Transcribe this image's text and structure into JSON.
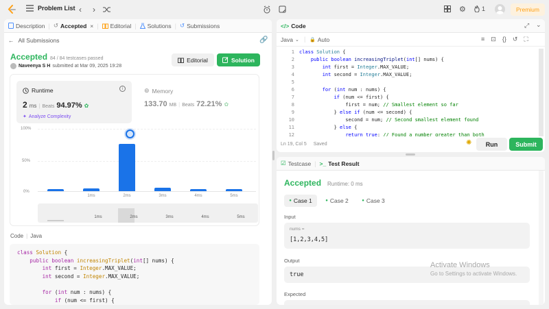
{
  "topbar": {
    "problem_list": "Problem List",
    "notifications": "1",
    "premium": "Premium"
  },
  "left_tabs": [
    {
      "label": "Description"
    },
    {
      "label": "Accepted"
    },
    {
      "label": "Editorial"
    },
    {
      "label": "Solutions"
    },
    {
      "label": "Submissions"
    }
  ],
  "submission": {
    "back": "All Submissions",
    "status": "Accepted",
    "passed": "84 / 84 testcases passed",
    "user": "Naveenya S H",
    "submitted": "submitted at Mar 09, 2025 19:28",
    "editorial_btn": "Editorial",
    "solution_btn": "Solution",
    "runtime_label": "Runtime",
    "runtime_value": "2",
    "runtime_unit": "ms",
    "beats": "Beats",
    "runtime_beats": "94.97%",
    "analyze": "Analyze Complexity",
    "memory_label": "Memory",
    "memory_value": "133.70",
    "memory_unit": "MB",
    "memory_beats": "72.21%"
  },
  "chart_data": {
    "type": "bar",
    "ylabels": [
      "100%",
      "50%",
      "0%"
    ],
    "categories": [
      "",
      "1ms",
      "2ms",
      "3ms",
      "4ms",
      "5ms"
    ],
    "values": [
      3,
      4,
      76,
      5,
      3,
      3
    ],
    "ylim": [
      0,
      100
    ],
    "mini_labels": [
      "1ms",
      "2ms",
      "3ms",
      "4ms",
      "5ms"
    ]
  },
  "left_code": {
    "label": "Code",
    "lang": "Java",
    "lines": [
      "class Solution {",
      "    public boolean increasingTriplet(int[] nums) {",
      "        int first = Integer.MAX_VALUE;",
      "        int second = Integer.MAX_VALUE;",
      "",
      "        for (int num : nums) {",
      "            if (num <= first) {"
    ]
  },
  "editor": {
    "title": "Code",
    "lang": "Java",
    "auto": "Auto",
    "lines": [
      "class Solution {",
      "    public boolean increasingTriplet(int[] nums) {",
      "        int first = Integer.MAX_VALUE;",
      "        int second = Integer.MAX_VALUE;",
      "",
      "        for (int num : nums) {",
      "            if (num <= first) {",
      "                first = num; // Smallest element so far",
      "            } else if (num <= second) {",
      "                second = num; // Second smallest element found",
      "            } else {",
      "                return true; // Found a number greater than both"
    ],
    "status": "Ln 19, Col 5",
    "saved": "Saved",
    "run": "Run",
    "submit": "Submit"
  },
  "result": {
    "testcase_tab": "Testcase",
    "result_tab": "Test Result",
    "status": "Accepted",
    "runtime": "Runtime: 0 ms",
    "cases": [
      "Case 1",
      "Case 2",
      "Case 3"
    ],
    "input_label": "Input",
    "var_name": "nums =",
    "input_value": "[1,2,3,4,5]",
    "output_label": "Output",
    "output_value": "true",
    "expected_label": "Expected"
  },
  "watermark": {
    "title": "Activate Windows",
    "sub": "Go to Settings to activate Windows."
  },
  "colors": {
    "accent": "#2db55d",
    "blue": "#1a73e8",
    "orange": "#ffa116"
  }
}
